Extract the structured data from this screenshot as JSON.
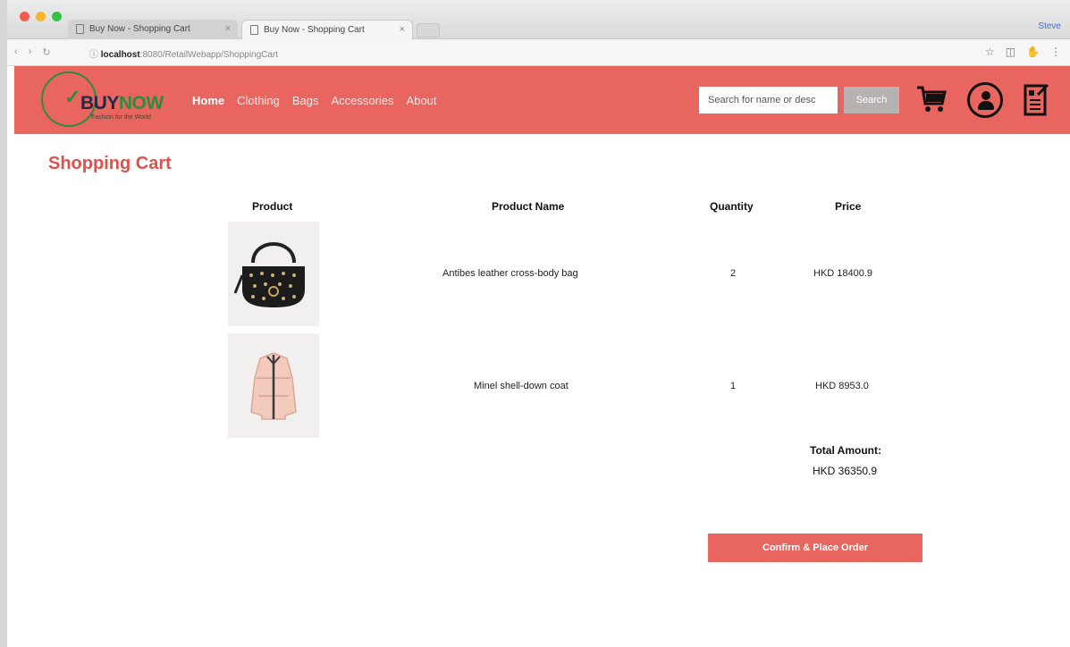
{
  "browser": {
    "tabs": [
      {
        "label": "Buy Now - Shopping Cart"
      },
      {
        "label": "Buy Now - Shopping Cart"
      }
    ],
    "url_host": "localhost",
    "url_path": ":8080/RetailWebapp/ShoppingCart",
    "profile": "Steve"
  },
  "site": {
    "logo": {
      "part1": "BUY",
      "part2": "NOW",
      "tagline": "Fashion for the World"
    },
    "nav": [
      "Home",
      "Clothing",
      "Bags",
      "Accessories",
      "About"
    ],
    "search": {
      "placeholder": "Search for name or desc",
      "button": "Search"
    },
    "colors": {
      "header": "#e8665f",
      "title": "#e0514b",
      "logo_green": "#2f8b3a"
    }
  },
  "cart": {
    "title": "Shopping Cart",
    "headers": {
      "product": "Product",
      "name": "Product Name",
      "quantity": "Quantity",
      "price": "Price"
    },
    "items": [
      {
        "image": "handbag-image",
        "name": "Antibes leather cross-body bag",
        "quantity": "2",
        "price": "HKD 18400.9"
      },
      {
        "image": "jacket-image",
        "name": "Minel shell-down coat",
        "quantity": "1",
        "price": "HKD 8953.0"
      }
    ],
    "total_label": "Total Amount:",
    "total_value": "HKD 36350.9",
    "confirm": "Confirm & Place Order"
  }
}
